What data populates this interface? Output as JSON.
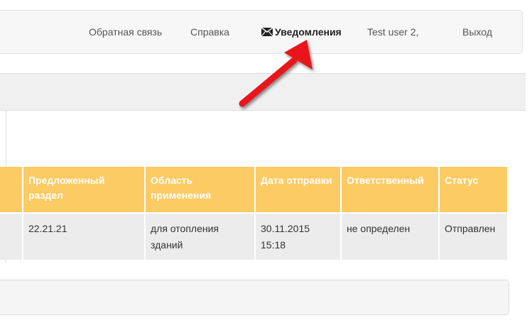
{
  "header": {
    "nav_items": [
      {
        "label": "Обратная связь"
      },
      {
        "label": "Справка"
      },
      {
        "label": "Уведомления",
        "icon": "envelope-icon"
      },
      {
        "label": "Test user 2,"
      },
      {
        "label": "Выход"
      }
    ]
  },
  "table": {
    "columns": [
      "",
      "Предложенный раздел",
      "Область применения",
      "Дата отправки",
      "Ответственный",
      "Статус"
    ],
    "rows": [
      {
        "cells": [
          "",
          "22.21.21",
          "для отопления зданий",
          "30.11.2015 15:18",
          "не определен",
          "Отправлен"
        ]
      }
    ]
  },
  "colors": {
    "table_header_bg": "#fdcb63",
    "table_row_bg": "#ececec",
    "annotation_arrow": "#e8151b"
  }
}
